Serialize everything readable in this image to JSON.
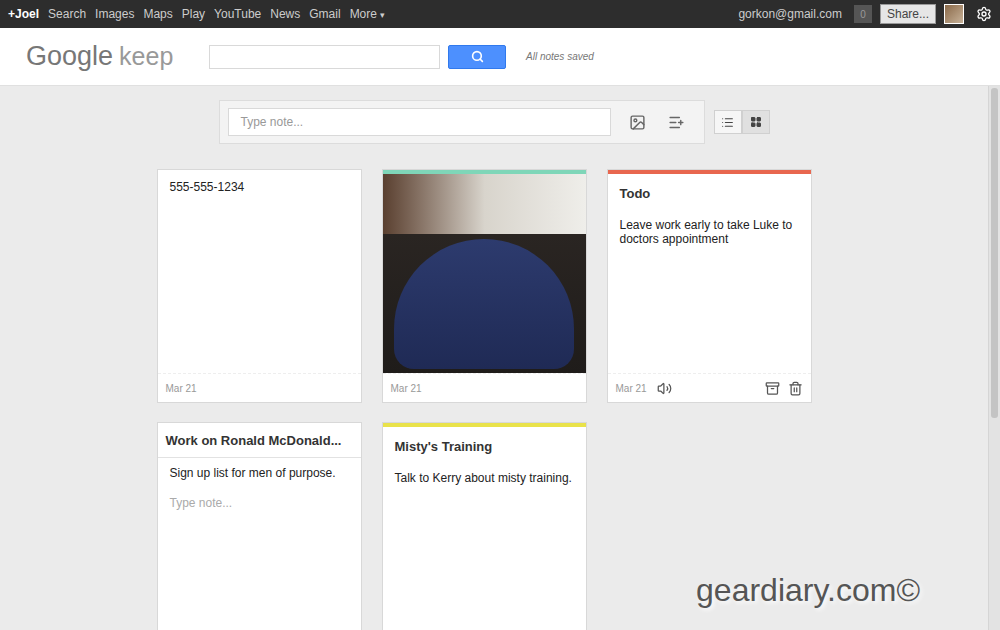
{
  "top_bar": {
    "links": [
      {
        "label": "+Joel",
        "bold": true
      },
      {
        "label": "Search",
        "bold": false
      },
      {
        "label": "Images",
        "bold": false
      },
      {
        "label": "Maps",
        "bold": false
      },
      {
        "label": "Play",
        "bold": false
      },
      {
        "label": "YouTube",
        "bold": false
      },
      {
        "label": "News",
        "bold": false
      },
      {
        "label": "Gmail",
        "bold": false
      },
      {
        "label": "More",
        "bold": false,
        "caret": "▾"
      }
    ],
    "account": "gorkon@gmail.com",
    "notifications": "0",
    "share": "Share..."
  },
  "header": {
    "logo": {
      "brand": "Google",
      "product": "keep"
    },
    "search": {
      "value": ""
    },
    "save_status": "All notes saved"
  },
  "composer": {
    "placeholder": "Type note..."
  },
  "view_modes": [
    {
      "kind": "list",
      "selected": false
    },
    {
      "kind": "grid",
      "selected": true
    }
  ],
  "notes": [
    {
      "kind": "text",
      "title": "",
      "body": "555-555-1234",
      "date": "Mar 21",
      "color": null,
      "hovered": false,
      "editing": false,
      "placeholder": ""
    },
    {
      "kind": "photo",
      "title": "",
      "body": "",
      "date": "Mar 21",
      "color": "#7fd6b8",
      "hovered": false,
      "editing": false,
      "placeholder": ""
    },
    {
      "kind": "text",
      "title": "Todo",
      "body": "Leave work early to take Luke to doctors appointment",
      "date": "Mar 21",
      "color": "#e8674f",
      "hovered": true,
      "editing": false,
      "placeholder": ""
    },
    {
      "kind": "text",
      "title": "Work on Ronald McDonald...",
      "body": "Sign up list for men of purpose.",
      "date": "",
      "color": null,
      "hovered": false,
      "editing": true,
      "placeholder": "Type note..."
    },
    {
      "kind": "text",
      "title": "Misty's Training",
      "body": "Talk to Kerry about misty training.",
      "date": "",
      "color": "#e9e24a",
      "hovered": false,
      "editing": false,
      "placeholder": ""
    }
  ],
  "watermark": "geardiary.com©"
}
